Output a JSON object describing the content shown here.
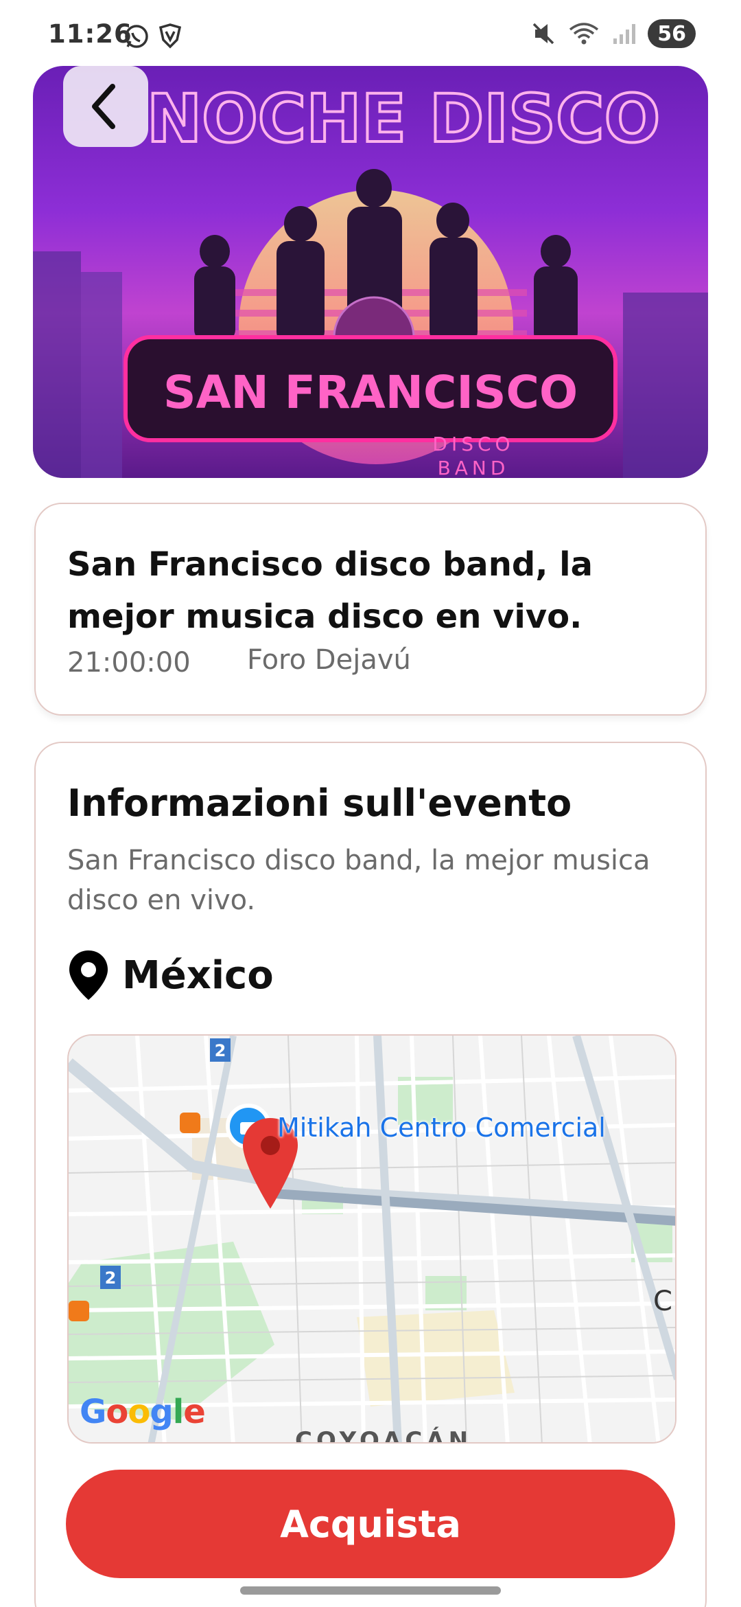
{
  "status_bar": {
    "time": "11:26",
    "battery": "56",
    "left_icons": [
      "whatsapp-icon",
      "vpn-shield-icon"
    ],
    "right_icons": [
      "mute-icon",
      "wifi-icon",
      "signal-icon",
      "battery-icon"
    ]
  },
  "banner": {
    "title": "NOCHE DISCO",
    "band_name": "SAN FRANCISCO",
    "subtitle_line1": "DISCO",
    "subtitle_line2": "BAND"
  },
  "event": {
    "title": "San Francisco disco band, la mejor musica disco en vivo.",
    "time": "21:00:00",
    "venue": "Foro Dejavú"
  },
  "info": {
    "heading": "Informazioni sull'evento",
    "description": "San Francisco disco band, la mejor musica disco en vivo.",
    "location": "México"
  },
  "map": {
    "poi_label": "Mitikah Centro Comercial",
    "metro_line_label": "2",
    "district_label": "COYOACÁN",
    "edge_label": "C",
    "attribution": "Google"
  },
  "actions": {
    "buy_label": "Acquista"
  }
}
